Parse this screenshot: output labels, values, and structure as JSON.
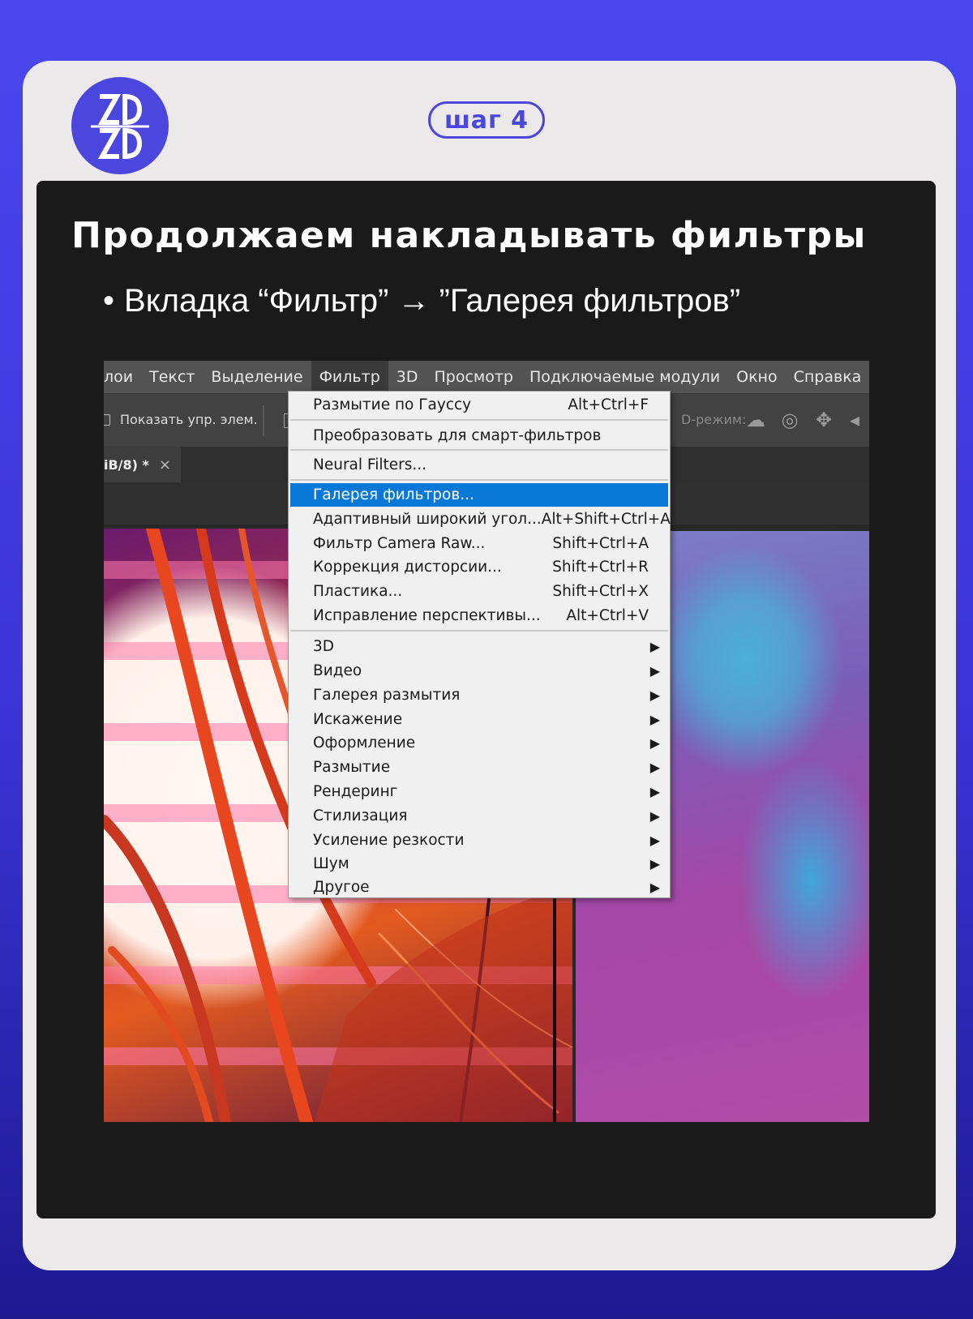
{
  "brand": {
    "logo_text": "ZD"
  },
  "step": {
    "label": "шаг 4"
  },
  "slide": {
    "heading": "Продолжаем накладывать фильтры",
    "bullet": "Вкладка “Фильтр” → ”Галерея фильтров”"
  },
  "app": {
    "menubar": [
      "лои",
      "Текст",
      "Выделение",
      "Фильтр",
      "3D",
      "Просмотр",
      "Подключаемые модули",
      "Окно",
      "Справка"
    ],
    "active_menu": "Фильтр",
    "options_bar": {
      "show_controls": "Показать упр. элем.",
      "mode_3d": "D-режим:"
    },
    "doc_tab": {
      "title": "iB/8) *",
      "close": "×"
    },
    "filter_menu": {
      "items": [
        {
          "label": "Размытие по Гауссу",
          "shortcut": "Alt+Ctrl+F"
        },
        {
          "label": "Преобразовать для смарт-фильтров",
          "shortcut": ""
        },
        {
          "label": "Neural Filters...",
          "shortcut": ""
        },
        {
          "label": "Галерея фильтров...",
          "shortcut": "",
          "highlighted": true
        },
        {
          "label": "Адаптивный широкий угол...",
          "shortcut": "Alt+Shift+Ctrl+A"
        },
        {
          "label": "Фильтр Camera Raw...",
          "shortcut": "Shift+Ctrl+A"
        },
        {
          "label": "Коррекция дисторсии...",
          "shortcut": "Shift+Ctrl+R"
        },
        {
          "label": "Пластика...",
          "shortcut": "Shift+Ctrl+X"
        },
        {
          "label": "Исправление перспективы...",
          "shortcut": "Alt+Ctrl+V"
        }
      ],
      "submenus": [
        "3D",
        "Видео",
        "Галерея размытия",
        "Искажение",
        "Оформление",
        "Размытие",
        "Рендеринг",
        "Стилизация",
        "Усиление резкости",
        "Шум",
        "Другое"
      ],
      "highlight_color": "#0a78d7"
    }
  }
}
